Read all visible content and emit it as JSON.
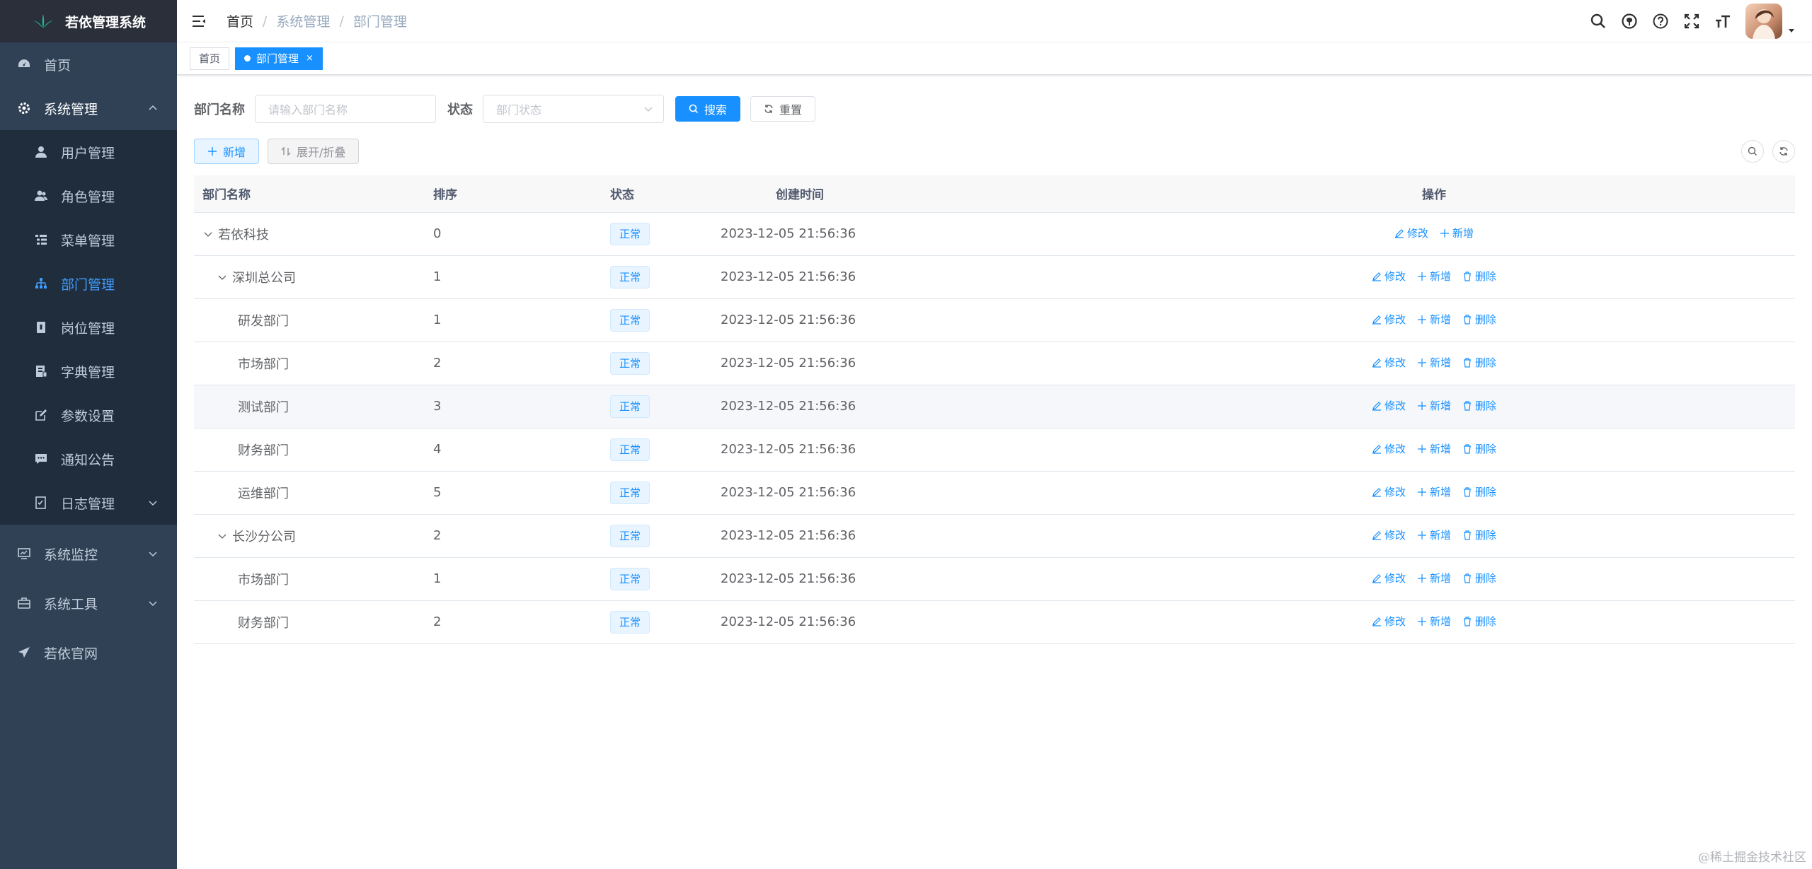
{
  "app": {
    "title": "若依管理系统"
  },
  "sidebar": {
    "items": [
      {
        "label": "首页",
        "icon": "dashboard-icon"
      },
      {
        "label": "系统管理",
        "icon": "gear-icon",
        "open": true,
        "children": [
          {
            "label": "用户管理",
            "icon": "user-icon"
          },
          {
            "label": "角色管理",
            "icon": "peoples-icon"
          },
          {
            "label": "菜单管理",
            "icon": "tree-table-icon"
          },
          {
            "label": "部门管理",
            "icon": "tree-icon",
            "active": true
          },
          {
            "label": "岗位管理",
            "icon": "post-icon"
          },
          {
            "label": "字典管理",
            "icon": "dict-icon"
          },
          {
            "label": "参数设置",
            "icon": "edit-icon"
          },
          {
            "label": "通知公告",
            "icon": "message-icon"
          },
          {
            "label": "日志管理",
            "icon": "log-icon"
          }
        ]
      },
      {
        "label": "系统监控",
        "icon": "monitor-icon"
      },
      {
        "label": "系统工具",
        "icon": "tool-icon"
      },
      {
        "label": "若依官网",
        "icon": "guide-icon"
      }
    ]
  },
  "navbar": {
    "breadcrumb": [
      "首页",
      "系统管理",
      "部门管理"
    ]
  },
  "tags": [
    {
      "label": "首页",
      "active": false
    },
    {
      "label": "部门管理",
      "active": true,
      "close": "×"
    }
  ],
  "search": {
    "dept_name_label": "部门名称",
    "dept_name_placeholder": "请输入部门名称",
    "status_label": "状态",
    "status_placeholder": "部门状态",
    "search_button": "搜索",
    "reset_button": "重置"
  },
  "toolbar": {
    "add_button": "新增",
    "expand_button": "展开/折叠"
  },
  "table": {
    "columns": [
      "部门名称",
      "排序",
      "状态",
      "创建时间",
      "操作"
    ],
    "rows": [
      {
        "name": "若依科技",
        "sort": "0",
        "status": "正常",
        "time": "2023-12-05 21:56:36",
        "level": 0,
        "toggle": true,
        "ops": [
          "修改",
          "新增"
        ]
      },
      {
        "name": "深圳总公司",
        "sort": "1",
        "status": "正常",
        "time": "2023-12-05 21:56:36",
        "level": 1,
        "toggle": true,
        "ops": [
          "修改",
          "新增",
          "删除"
        ]
      },
      {
        "name": "研发部门",
        "sort": "1",
        "status": "正常",
        "time": "2023-12-05 21:56:36",
        "level": 2,
        "toggle": false,
        "ops": [
          "修改",
          "新增",
          "删除"
        ]
      },
      {
        "name": "市场部门",
        "sort": "2",
        "status": "正常",
        "time": "2023-12-05 21:56:36",
        "level": 2,
        "toggle": false,
        "ops": [
          "修改",
          "新增",
          "删除"
        ]
      },
      {
        "name": "测试部门",
        "sort": "3",
        "status": "正常",
        "time": "2023-12-05 21:56:36",
        "level": 2,
        "toggle": false,
        "ops": [
          "修改",
          "新增",
          "删除"
        ],
        "hover": true
      },
      {
        "name": "财务部门",
        "sort": "4",
        "status": "正常",
        "time": "2023-12-05 21:56:36",
        "level": 2,
        "toggle": false,
        "ops": [
          "修改",
          "新增",
          "删除"
        ]
      },
      {
        "name": "运维部门",
        "sort": "5",
        "status": "正常",
        "time": "2023-12-05 21:56:36",
        "level": 2,
        "toggle": false,
        "ops": [
          "修改",
          "新增",
          "删除"
        ]
      },
      {
        "name": "长沙分公司",
        "sort": "2",
        "status": "正常",
        "time": "2023-12-05 21:56:36",
        "level": 1,
        "toggle": true,
        "ops": [
          "修改",
          "新增",
          "删除"
        ]
      },
      {
        "name": "市场部门",
        "sort": "1",
        "status": "正常",
        "time": "2023-12-05 21:56:36",
        "level": 2,
        "toggle": false,
        "ops": [
          "修改",
          "新增",
          "删除"
        ]
      },
      {
        "name": "财务部门",
        "sort": "2",
        "status": "正常",
        "time": "2023-12-05 21:56:36",
        "level": 2,
        "toggle": false,
        "ops": [
          "修改",
          "新增",
          "删除"
        ]
      }
    ]
  },
  "footer_watermark": "@稀土掘金技术社区",
  "colors": {
    "sidebar_bg": "#304156",
    "submenu_bg": "#1f2d3d",
    "primary": "#1890ff",
    "active_menu": "#409eff"
  }
}
